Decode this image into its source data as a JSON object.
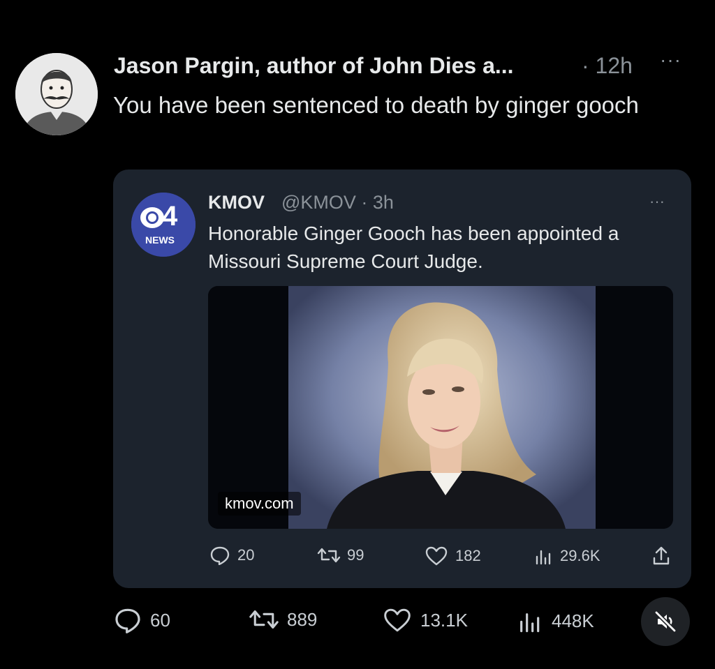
{
  "tweet": {
    "author": "Jason Pargin, author of John Dies a...",
    "time": "· 12h",
    "more": "···",
    "text": "You have been sentenced to death by ginger gooch",
    "stats": {
      "replies": "60",
      "retweets": "889",
      "likes": "13.1K",
      "views": "448K"
    }
  },
  "quote": {
    "logo_channel": "4",
    "logo_label": "NEWS",
    "name": "KMOV",
    "handle": "@KMOV · 3h",
    "more": "···",
    "text": "Honorable Ginger Gooch has been appointed a Missouri Supreme Court Judge.",
    "image_source": "kmov.com",
    "stats": {
      "replies": "20",
      "retweets": "99",
      "likes": "182",
      "views": "29.6K"
    }
  },
  "icons": {
    "reply": "speech-bubble-icon",
    "retweet": "retweet-arrows-icon",
    "like": "heart-icon",
    "views": "bar-chart-icon",
    "share": "share-upload-icon",
    "mute": "speaker-muted-icon"
  },
  "colors": {
    "background": "#000000",
    "card": "#1c232d",
    "muted_text": "#8b9299",
    "logo_blue": "#3a49a8"
  }
}
